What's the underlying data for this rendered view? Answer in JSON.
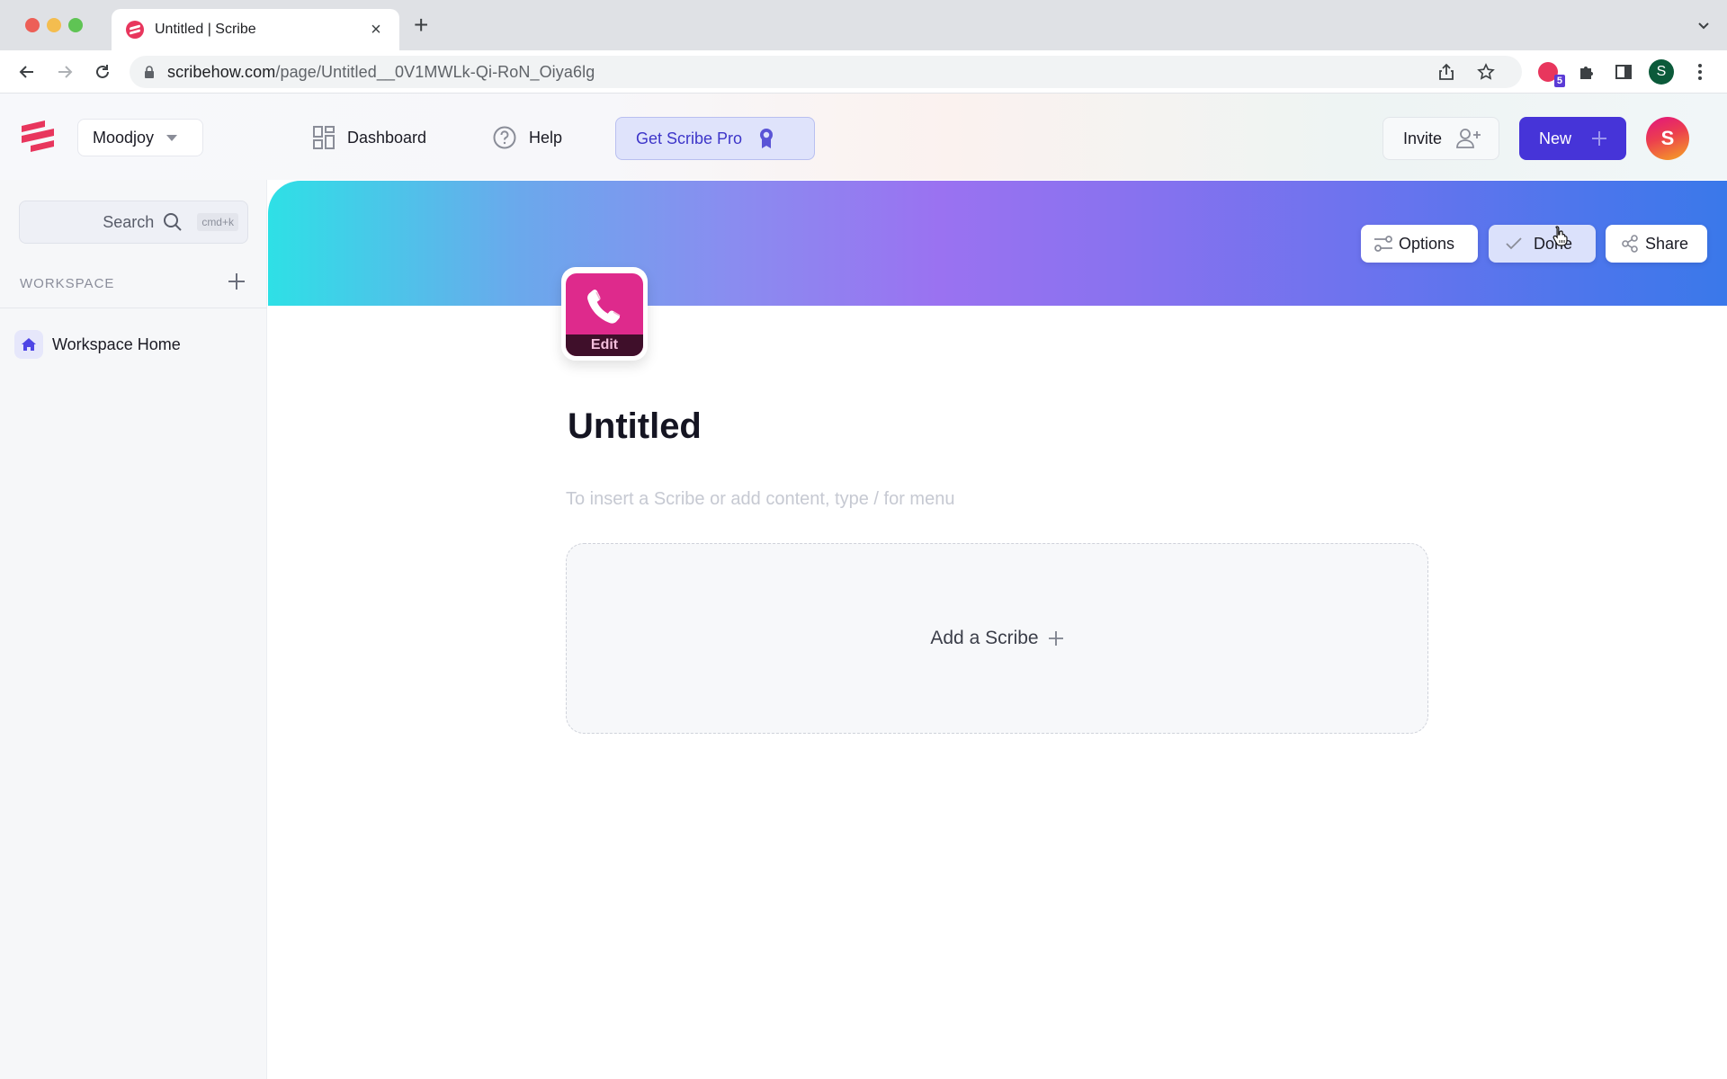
{
  "browser": {
    "tab_title": "Untitled | Scribe",
    "tab_close": "×",
    "new_tab": "+",
    "url_host": "scribehow.com",
    "url_path": "/page/Untitled__0V1MWLk-Qi-RoN_Oiya6lg",
    "extension_badge": "5",
    "profile_initial": "S"
  },
  "header": {
    "workspace_name": "Moodjoy",
    "nav": [
      {
        "label": "Dashboard",
        "icon": "dashboard-icon"
      },
      {
        "label": "Help",
        "icon": "help-icon"
      }
    ],
    "pro_button": "Get Scribe Pro",
    "invite_button": "Invite",
    "new_button": "New",
    "avatar_initial": "S",
    "colors": {
      "primary": "#4634d8",
      "brand": "#e8365d"
    }
  },
  "sidebar": {
    "search_label": "Search",
    "search_shortcut": "cmd+k",
    "section_heading": "WORKSPACE",
    "items": [
      {
        "label": "Workspace Home",
        "icon": "home-icon"
      }
    ]
  },
  "main": {
    "banner_buttons": {
      "options": "Options",
      "done": "Done",
      "share": "Share"
    },
    "page_icon": {
      "icon": "phone-icon",
      "edit_label": "Edit",
      "color": "#de2a8c"
    },
    "title": "Untitled",
    "editor_placeholder": "To insert a Scribe or add content, type / for menu",
    "add_scribe_label": "Add a Scribe"
  }
}
